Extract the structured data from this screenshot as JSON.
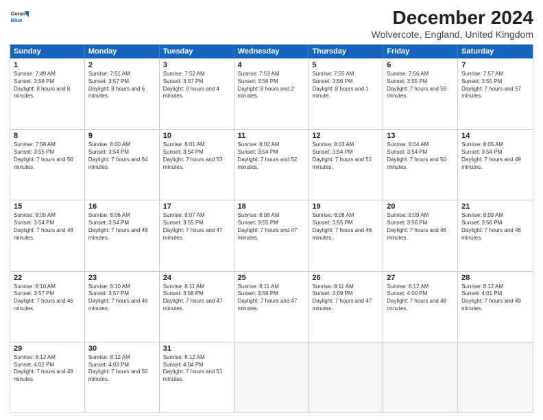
{
  "header": {
    "logo_line1": "General",
    "logo_line2": "Blue",
    "month": "December 2024",
    "location": "Wolvercote, England, United Kingdom"
  },
  "days_of_week": [
    "Sunday",
    "Monday",
    "Tuesday",
    "Wednesday",
    "Thursday",
    "Friday",
    "Saturday"
  ],
  "weeks": [
    [
      {
        "day": "1",
        "rise": "7:49 AM",
        "set": "3:58 PM",
        "daylight": "8 hours and 8 minutes"
      },
      {
        "day": "2",
        "rise": "7:51 AM",
        "set": "3:57 PM",
        "daylight": "8 hours and 6 minutes"
      },
      {
        "day": "3",
        "rise": "7:52 AM",
        "set": "3:57 PM",
        "daylight": "8 hours and 4 minutes"
      },
      {
        "day": "4",
        "rise": "7:53 AM",
        "set": "3:56 PM",
        "daylight": "8 hours and 2 minutes"
      },
      {
        "day": "5",
        "rise": "7:55 AM",
        "set": "3:56 PM",
        "daylight": "8 hours and 1 minute"
      },
      {
        "day": "6",
        "rise": "7:56 AM",
        "set": "3:55 PM",
        "daylight": "7 hours and 59 minutes"
      },
      {
        "day": "7",
        "rise": "7:57 AM",
        "set": "3:55 PM",
        "daylight": "7 hours and 57 minutes"
      }
    ],
    [
      {
        "day": "8",
        "rise": "7:58 AM",
        "set": "3:55 PM",
        "daylight": "7 hours and 56 minutes"
      },
      {
        "day": "9",
        "rise": "8:00 AM",
        "set": "3:54 PM",
        "daylight": "7 hours and 54 minutes"
      },
      {
        "day": "10",
        "rise": "8:01 AM",
        "set": "3:54 PM",
        "daylight": "7 hours and 53 minutes"
      },
      {
        "day": "11",
        "rise": "8:02 AM",
        "set": "3:54 PM",
        "daylight": "7 hours and 52 minutes"
      },
      {
        "day": "12",
        "rise": "8:03 AM",
        "set": "3:54 PM",
        "daylight": "7 hours and 51 minutes"
      },
      {
        "day": "13",
        "rise": "8:04 AM",
        "set": "3:54 PM",
        "daylight": "7 hours and 50 minutes"
      },
      {
        "day": "14",
        "rise": "8:05 AM",
        "set": "3:54 PM",
        "daylight": "7 hours and 49 minutes"
      }
    ],
    [
      {
        "day": "15",
        "rise": "8:05 AM",
        "set": "3:54 PM",
        "daylight": "7 hours and 48 minutes"
      },
      {
        "day": "16",
        "rise": "8:06 AM",
        "set": "3:54 PM",
        "daylight": "7 hours and 48 minutes"
      },
      {
        "day": "17",
        "rise": "8:07 AM",
        "set": "3:55 PM",
        "daylight": "7 hours and 47 minutes"
      },
      {
        "day": "18",
        "rise": "8:08 AM",
        "set": "3:55 PM",
        "daylight": "7 hours and 47 minutes"
      },
      {
        "day": "19",
        "rise": "8:08 AM",
        "set": "3:55 PM",
        "daylight": "7 hours and 46 minutes"
      },
      {
        "day": "20",
        "rise": "8:09 AM",
        "set": "3:56 PM",
        "daylight": "7 hours and 46 minutes"
      },
      {
        "day": "21",
        "rise": "8:09 AM",
        "set": "3:56 PM",
        "daylight": "7 hours and 46 minutes"
      }
    ],
    [
      {
        "day": "22",
        "rise": "8:10 AM",
        "set": "3:57 PM",
        "daylight": "7 hours and 46 minutes"
      },
      {
        "day": "23",
        "rise": "8:10 AM",
        "set": "3:57 PM",
        "daylight": "7 hours and 46 minutes"
      },
      {
        "day": "24",
        "rise": "8:11 AM",
        "set": "3:58 PM",
        "daylight": "7 hours and 47 minutes"
      },
      {
        "day": "25",
        "rise": "8:11 AM",
        "set": "3:58 PM",
        "daylight": "7 hours and 47 minutes"
      },
      {
        "day": "26",
        "rise": "8:11 AM",
        "set": "3:59 PM",
        "daylight": "7 hours and 47 minutes"
      },
      {
        "day": "27",
        "rise": "8:12 AM",
        "set": "4:00 PM",
        "daylight": "7 hours and 48 minutes"
      },
      {
        "day": "28",
        "rise": "8:12 AM",
        "set": "4:01 PM",
        "daylight": "7 hours and 49 minutes"
      }
    ],
    [
      {
        "day": "29",
        "rise": "8:12 AM",
        "set": "4:02 PM",
        "daylight": "7 hours and 49 minutes"
      },
      {
        "day": "30",
        "rise": "8:12 AM",
        "set": "4:03 PM",
        "daylight": "7 hours and 50 minutes"
      },
      {
        "day": "31",
        "rise": "8:12 AM",
        "set": "4:04 PM",
        "daylight": "7 hours and 51 minutes"
      },
      null,
      null,
      null,
      null
    ]
  ]
}
